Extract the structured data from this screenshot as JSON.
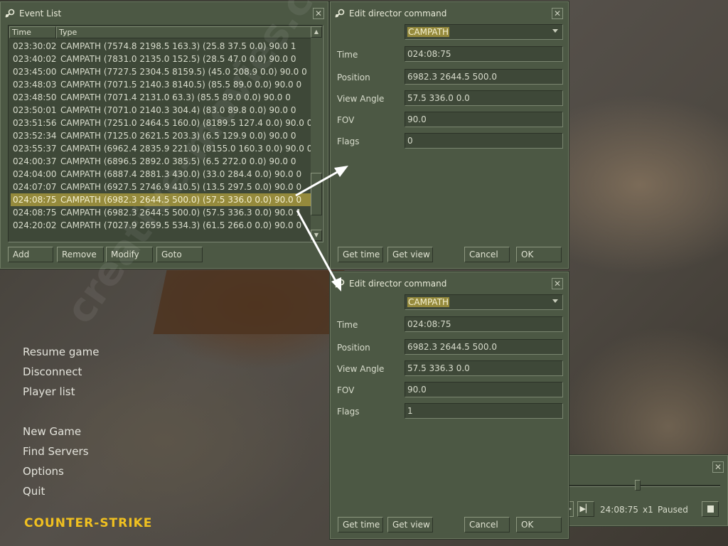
{
  "event_list": {
    "title": "Event List",
    "columns": [
      "Time",
      "Type"
    ],
    "rows": [
      {
        "time": "023:30:02",
        "type": "CAMPATH (7574.8 2198.5 163.3) (25.8 37.5 0.0) 90.0 1"
      },
      {
        "time": "023:40:02",
        "type": "CAMPATH (7831.0 2135.0 152.5) (28.5 47.0 0.0) 90.0 0"
      },
      {
        "time": "023:45:00",
        "type": "CAMPATH (7727.5 2304.5 8159.5) (45.0 208.9 0.0) 90.0 0"
      },
      {
        "time": "023:48:03",
        "type": "CAMPATH (7071.5 2140.3 8140.5) (85.5 89.0 0.0) 90.0 0"
      },
      {
        "time": "023:48:50",
        "type": "CAMPATH (7071.4 2131.0 63.3) (85.5 89.0 0.0) 90.0 0"
      },
      {
        "time": "023:50:01",
        "type": "CAMPATH (7071.0 2140.3 304.4) (83.0 89.8 0.0) 90.0 0"
      },
      {
        "time": "023:51:56",
        "type": "CAMPATH (7251.0 2464.5 160.0) (8189.5 127.4 0.0) 90.0 0"
      },
      {
        "time": "023:52:34",
        "type": "CAMPATH (7125.0 2621.5 203.3) (6.5 129.9 0.0) 90.0 0"
      },
      {
        "time": "023:55:37",
        "type": "CAMPATH (6962.4 2835.9 221.0) (8155.0 160.3 0.0) 90.0 0"
      },
      {
        "time": "024:00:37",
        "type": "CAMPATH (6896.5 2892.0 385.5) (6.5 272.0 0.0) 90.0 0"
      },
      {
        "time": "024:04:00",
        "type": "CAMPATH (6887.4 2881.3 430.0) (33.0 284.4 0.0) 90.0 0"
      },
      {
        "time": "024:07:07",
        "type": "CAMPATH (6927.5 2746.9 410.5) (13.5 297.5 0.0) 90.0 0"
      },
      {
        "time": "024:08:75",
        "type": "CAMPATH (6982.3 2644.5 500.0) (57.5 336.0 0.0) 90.0 0"
      },
      {
        "time": "024:08:75",
        "type": "CAMPATH (6982.3 2644.5 500.0) (57.5 336.3 0.0) 90.0 1"
      },
      {
        "time": "024:20:02",
        "type": "CAMPATH (7027.9 2659.5 534.3) (61.5 266.0 0.0) 90.0 0"
      }
    ],
    "selected_index": 12,
    "buttons": {
      "add": "Add",
      "remove": "Remove",
      "modify": "Modify",
      "goto": "Goto"
    }
  },
  "dialog1": {
    "title": "Edit director command",
    "command": "CAMPATH",
    "labels": {
      "time": "Time",
      "position": "Position",
      "view_angle": "View Angle",
      "fov": "FOV",
      "flags": "Flags"
    },
    "values": {
      "time": "024:08:75",
      "position": "6982.3 2644.5 500.0",
      "view_angle": "57.5 336.0 0.0",
      "fov": "90.0",
      "flags": "0"
    },
    "buttons": {
      "get_time": "Get time",
      "get_view": "Get view",
      "cancel": "Cancel",
      "ok": "OK"
    }
  },
  "dialog2": {
    "title": "Edit director command",
    "command": "CAMPATH",
    "labels": {
      "time": "Time",
      "position": "Position",
      "view_angle": "View Angle",
      "fov": "FOV",
      "flags": "Flags"
    },
    "values": {
      "time": "024:08:75",
      "position": "6982.3 2644.5 500.0",
      "view_angle": "57.5 336.3 0.0",
      "fov": "90.0",
      "flags": "1"
    },
    "buttons": {
      "get_time": "Get time",
      "get_view": "Get view",
      "cancel": "Cancel",
      "ok": "OK"
    }
  },
  "playback": {
    "time": "24:08:75",
    "speed": "x1",
    "status": "Paused",
    "progress": 0.45
  },
  "main_menu": {
    "items": [
      "Resume game",
      "Disconnect",
      "Player list",
      "New Game",
      "Find Servers",
      "Options",
      "Quit"
    ]
  },
  "logo_text": "COUNTER-STRIKE",
  "watermark": "creative-movies.com",
  "colors": {
    "panel": "#4c5844",
    "selection": "#958a3c",
    "logo": "#f0c020"
  }
}
